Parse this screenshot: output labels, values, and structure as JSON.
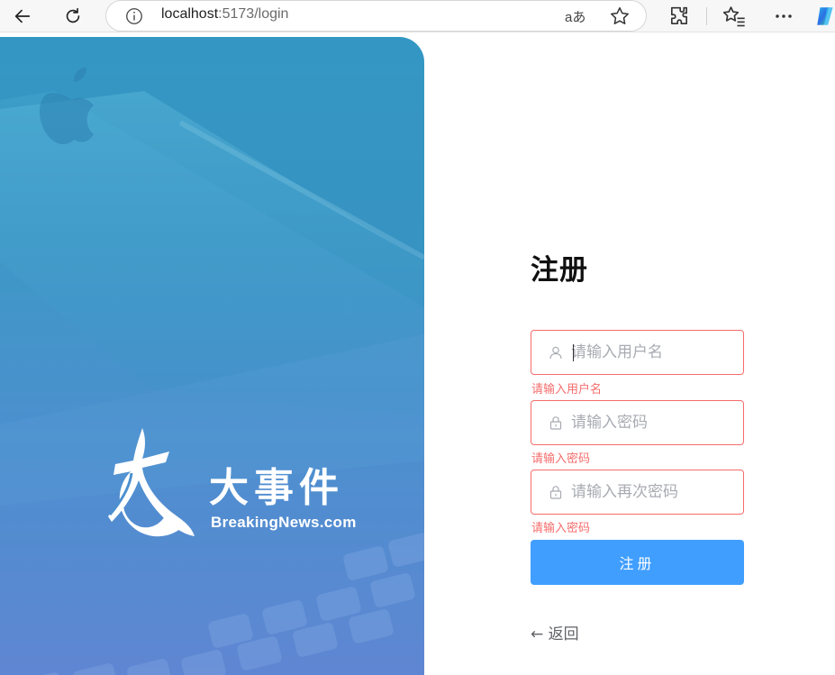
{
  "browser": {
    "url_host": "localhost",
    "url_rest": ":5173/login",
    "read_aloud_label": "aあ"
  },
  "brand": {
    "name_cn": "大事件",
    "site": "BreakingNews.com"
  },
  "form": {
    "title": "注册",
    "username_placeholder": "请输入用户名",
    "username_error": "请输入用户名",
    "password_placeholder": "请输入密码",
    "password_error": "请输入密码",
    "repassword_placeholder": "请输入再次密码",
    "repassword_error": "请输入密码",
    "submit_label": "注册",
    "back_label": "← 返回"
  },
  "colors": {
    "error": "#f56c6c",
    "primary": "#409eff"
  }
}
